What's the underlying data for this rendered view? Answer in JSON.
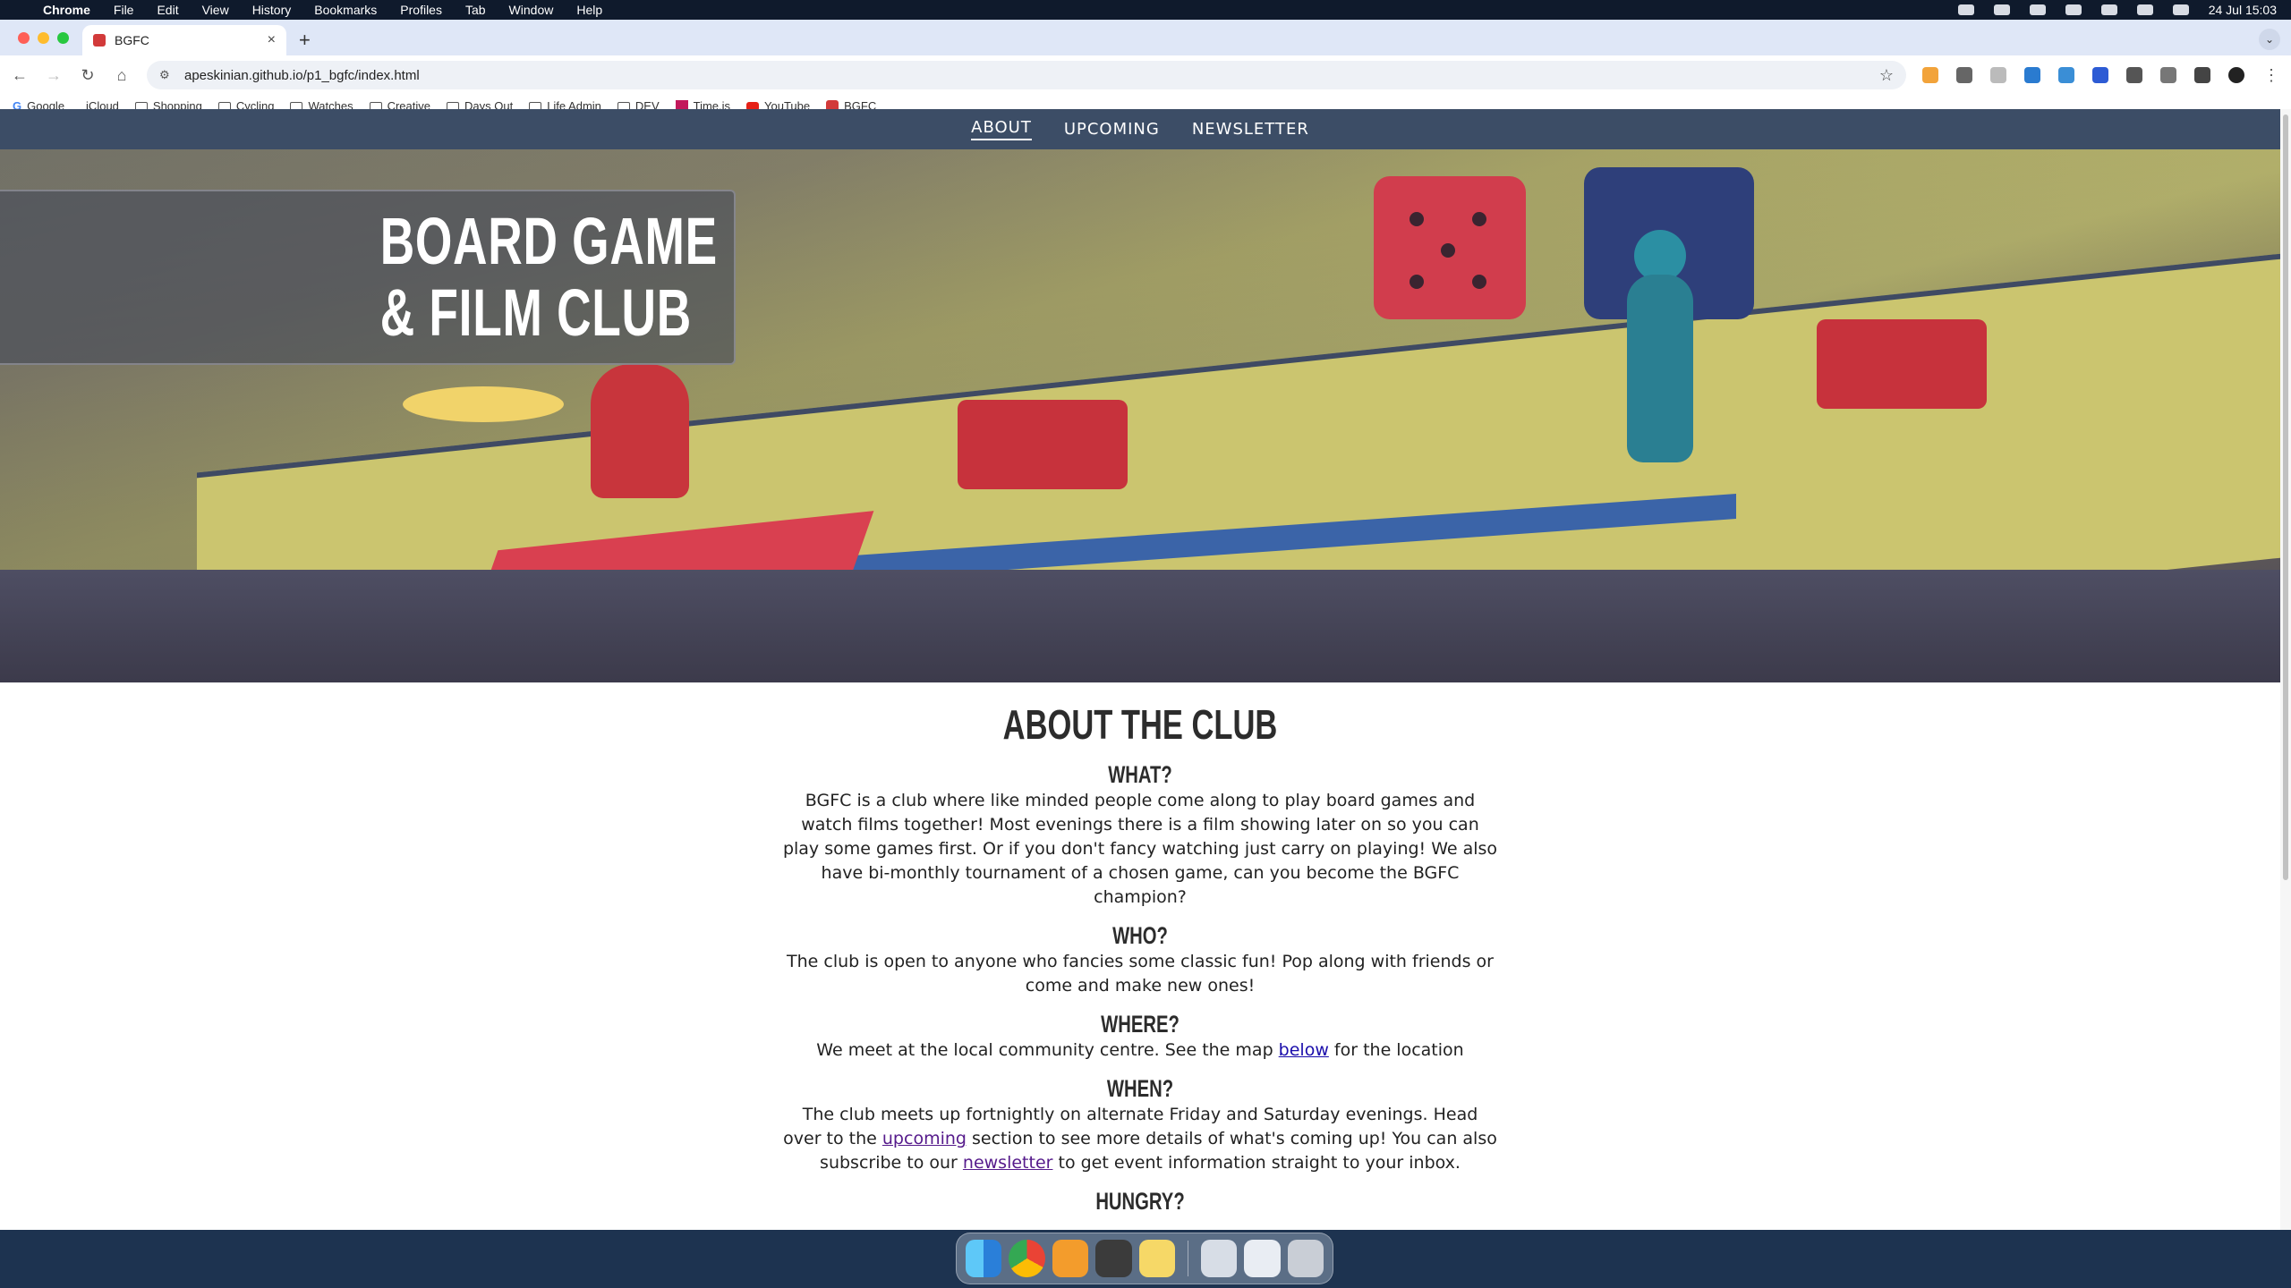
{
  "menubar": {
    "app_name": "Chrome",
    "items": [
      "File",
      "Edit",
      "View",
      "History",
      "Bookmarks",
      "Profiles",
      "Tab",
      "Window",
      "Help"
    ],
    "clock": "24 Jul  15:03"
  },
  "browser": {
    "tab_title": "BGFC",
    "url": "apeskinian.github.io/p1_bgfc/index.html",
    "bookmarks": [
      "Google",
      "iCloud",
      "Shopping",
      "Cycling",
      "Watches",
      "Creative",
      "Days Out",
      "Life Admin",
      "DEV",
      "Time.is",
      "YouTube",
      "BGFC"
    ]
  },
  "site": {
    "nav": [
      "ABOUT",
      "UPCOMING",
      "NEWSLETTER"
    ],
    "hero_title_line1": "BOARD GAME",
    "hero_title_line2": "& FILM CLUB",
    "about_heading": "ABOUT THE CLUB",
    "what_heading": "WHAT?",
    "what_text": "BGFC is a club where like minded people come along to play board games and watch films together! Most evenings there is a film showing later on so you can play some games first. Or if you don't fancy watching just carry on playing! We also have bi-monthly tournament of a chosen game, can you become the BGFC champion?",
    "who_heading": "WHO?",
    "who_text": "The club is open to anyone who fancies some classic fun! Pop along with friends or come and make new ones!",
    "where_heading": "WHERE?",
    "where_text_before": "We meet at the local community centre. See the map ",
    "where_link": "below",
    "where_text_after": " for the location",
    "when_heading": "WHEN?",
    "when_text_1": "The club meets up fortnightly on alternate Friday and Saturday evenings. Head over to the ",
    "when_link_1": "upcoming",
    "when_text_2": " section to see more details of what's coming up! You can also subscribe to our ",
    "when_link_2": "newsletter",
    "when_text_3": " to get event information straight to your inbox.",
    "hungry_heading": "HUNGRY?"
  }
}
